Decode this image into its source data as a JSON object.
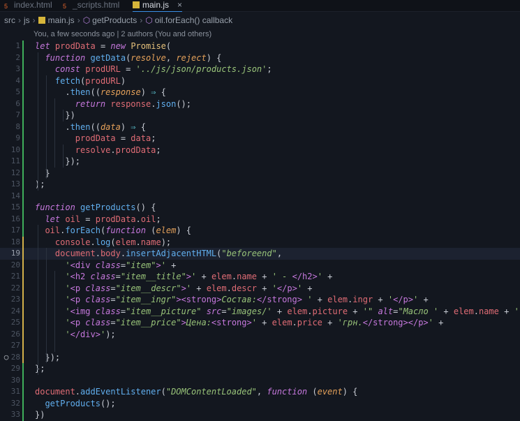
{
  "tabs": [
    {
      "label": "index.html",
      "icon": "html5-icon",
      "active": false
    },
    {
      "label": "_scripts.html",
      "icon": "html5-icon",
      "active": false
    },
    {
      "label": "main.js",
      "icon": "js-file-icon",
      "active": true
    }
  ],
  "tab_close_glyph": "×",
  "breadcrumb": [
    "src",
    "js",
    "main.js",
    "getProducts",
    "oil.forEach() callback"
  ],
  "blame": "You, a few seconds ago | 2 authors (You and others)",
  "current_line": 19,
  "colors": {
    "background": "#13171f",
    "keyword": "#c678dd",
    "function": "#61afef",
    "string": "#98c379",
    "variable": "#e06c75",
    "git_added": "#d2b04a",
    "git_new": "#3fae5a"
  },
  "lines": [
    {
      "n": "1",
      "marker": "",
      "git": "new",
      "tokens": [
        [
          "k",
          "let"
        ],
        [
          "pu",
          " "
        ],
        [
          "vr",
          "prodData"
        ],
        [
          "pu",
          " = "
        ],
        [
          "k",
          "new"
        ],
        [
          "pu",
          " "
        ],
        [
          "cl",
          "Promise"
        ],
        [
          "pu",
          "("
        ]
      ]
    },
    {
      "n": "2",
      "marker": "",
      "git": "new",
      "tokens": [
        [
          "pu",
          "  "
        ],
        [
          "k",
          "function"
        ],
        [
          "pu",
          " "
        ],
        [
          "fn",
          "getData"
        ],
        [
          "pu",
          "("
        ],
        [
          "par",
          "resolve"
        ],
        [
          "pu",
          ", "
        ],
        [
          "par",
          "reject"
        ],
        [
          "pu",
          ") {"
        ]
      ]
    },
    {
      "n": "3",
      "marker": "",
      "git": "new",
      "tokens": [
        [
          "pu",
          "    "
        ],
        [
          "k",
          "const"
        ],
        [
          "pu",
          " "
        ],
        [
          "vr",
          "prodURL"
        ],
        [
          "pu",
          " = "
        ],
        [
          "str",
          "'../js/json/products.json'"
        ],
        [
          "pu",
          ";"
        ]
      ]
    },
    {
      "n": "4",
      "marker": "",
      "git": "new",
      "tokens": [
        [
          "pu",
          "    "
        ],
        [
          "fn",
          "fetch"
        ],
        [
          "pu",
          "("
        ],
        [
          "vr",
          "prodURL"
        ],
        [
          "pu",
          ")"
        ]
      ]
    },
    {
      "n": "5",
      "marker": "",
      "git": "new",
      "tokens": [
        [
          "pu",
          "      ."
        ],
        [
          "fn",
          "then"
        ],
        [
          "pu",
          "(("
        ],
        [
          "par",
          "response"
        ],
        [
          "pu",
          ") "
        ],
        [
          "op",
          "⇒"
        ],
        [
          "pu",
          " {"
        ]
      ]
    },
    {
      "n": "6",
      "marker": "",
      "git": "new",
      "tokens": [
        [
          "pu",
          "        "
        ],
        [
          "k",
          "return"
        ],
        [
          "pu",
          " "
        ],
        [
          "vr",
          "response"
        ],
        [
          "pu",
          "."
        ],
        [
          "fn",
          "json"
        ],
        [
          "pu",
          "();"
        ]
      ]
    },
    {
      "n": "7",
      "marker": "",
      "git": "new",
      "tokens": [
        [
          "pu",
          "      })"
        ]
      ]
    },
    {
      "n": "8",
      "marker": "",
      "git": "new",
      "tokens": [
        [
          "pu",
          "      ."
        ],
        [
          "fn",
          "then"
        ],
        [
          "pu",
          "(("
        ],
        [
          "par",
          "data"
        ],
        [
          "pu",
          ") "
        ],
        [
          "op",
          "⇒"
        ],
        [
          "pu",
          " {"
        ]
      ]
    },
    {
      "n": "9",
      "marker": "",
      "git": "new",
      "tokens": [
        [
          "pu",
          "        "
        ],
        [
          "vr",
          "prodData"
        ],
        [
          "pu",
          " = "
        ],
        [
          "vr",
          "data"
        ],
        [
          "pu",
          ";"
        ]
      ]
    },
    {
      "n": "10",
      "marker": "",
      "git": "new",
      "tokens": [
        [
          "pu",
          "        "
        ],
        [
          "vr",
          "resolve"
        ],
        [
          "pu",
          "."
        ],
        [
          "pr",
          "prodData"
        ],
        [
          "pu",
          ";"
        ]
      ]
    },
    {
      "n": "11",
      "marker": "",
      "git": "new",
      "tokens": [
        [
          "pu",
          "      });"
        ]
      ]
    },
    {
      "n": "12",
      "marker": "",
      "git": "new",
      "tokens": [
        [
          "pu",
          "  }"
        ]
      ]
    },
    {
      "n": "13",
      "marker": "",
      "git": "new",
      "tokens": [
        [
          "pu",
          ");"
        ]
      ]
    },
    {
      "n": "14",
      "marker": "",
      "git": "new",
      "tokens": []
    },
    {
      "n": "15",
      "marker": "",
      "git": "new",
      "tokens": [
        [
          "k",
          "function"
        ],
        [
          "pu",
          " "
        ],
        [
          "fn",
          "getProducts"
        ],
        [
          "pu",
          "() {"
        ]
      ]
    },
    {
      "n": "16",
      "marker": "",
      "git": "new",
      "tokens": [
        [
          "pu",
          "  "
        ],
        [
          "k",
          "let"
        ],
        [
          "pu",
          " "
        ],
        [
          "vr",
          "oil"
        ],
        [
          "pu",
          " = "
        ],
        [
          "vr",
          "prodData"
        ],
        [
          "pu",
          "."
        ],
        [
          "pr",
          "oil"
        ],
        [
          "pu",
          ";"
        ]
      ]
    },
    {
      "n": "17",
      "marker": "",
      "git": "new",
      "tokens": [
        [
          "pu",
          "  "
        ],
        [
          "vr",
          "oil"
        ],
        [
          "pu",
          "."
        ],
        [
          "fn",
          "forEach"
        ],
        [
          "pu",
          "("
        ],
        [
          "k",
          "function"
        ],
        [
          "pu",
          " ("
        ],
        [
          "par",
          "elem"
        ],
        [
          "pu",
          ") "
        ],
        [
          "pu",
          "{"
        ]
      ]
    },
    {
      "n": "18",
      "marker": "",
      "git": "added",
      "tokens": [
        [
          "pu",
          "    "
        ],
        [
          "vr",
          "console"
        ],
        [
          "pu",
          "."
        ],
        [
          "fn",
          "log"
        ],
        [
          "pu",
          "("
        ],
        [
          "vr",
          "elem"
        ],
        [
          "pu",
          "."
        ],
        [
          "pr",
          "name"
        ],
        [
          "pu",
          ");"
        ]
      ]
    },
    {
      "n": "19",
      "marker": "",
      "git": "added",
      "tokens": [
        [
          "pu",
          "    "
        ],
        [
          "vr",
          "document"
        ],
        [
          "pu",
          "."
        ],
        [
          "pr",
          "body"
        ],
        [
          "pu",
          "."
        ],
        [
          "fn",
          "insertAdjacentHTML"
        ],
        [
          "pu",
          "("
        ],
        [
          "str",
          "\"beforeend\""
        ],
        [
          "pu",
          ","
        ]
      ]
    },
    {
      "n": "20",
      "marker": "",
      "git": "added",
      "tokens": [
        [
          "pu",
          "      "
        ],
        [
          "str",
          "'"
        ],
        [
          "tg",
          "<div"
        ],
        [
          "pu",
          " "
        ],
        [
          "at",
          "class"
        ],
        [
          "pu",
          "="
        ],
        [
          "str",
          "\"item\""
        ],
        [
          "tg",
          ">"
        ],
        [
          "str",
          "'"
        ],
        [
          "pu",
          " +"
        ]
      ]
    },
    {
      "n": "21",
      "marker": "",
      "git": "added",
      "tokens": [
        [
          "pu",
          "      "
        ],
        [
          "str",
          "'"
        ],
        [
          "tg",
          "<h2"
        ],
        [
          "pu",
          " "
        ],
        [
          "at",
          "class"
        ],
        [
          "pu",
          "="
        ],
        [
          "str",
          "\"item__title\""
        ],
        [
          "tg",
          ">"
        ],
        [
          "str",
          "'"
        ],
        [
          "pu",
          " + "
        ],
        [
          "vr",
          "elem"
        ],
        [
          "pu",
          "."
        ],
        [
          "pr",
          "name"
        ],
        [
          "pu",
          " + "
        ],
        [
          "str",
          "' - "
        ],
        [
          "tg",
          "</h2>"
        ],
        [
          "str",
          "'"
        ],
        [
          "pu",
          " +"
        ]
      ]
    },
    {
      "n": "22",
      "marker": "",
      "git": "added",
      "tokens": [
        [
          "pu",
          "      "
        ],
        [
          "str",
          "'"
        ],
        [
          "tg",
          "<p"
        ],
        [
          "pu",
          " "
        ],
        [
          "at",
          "class"
        ],
        [
          "pu",
          "="
        ],
        [
          "str",
          "\"item__descr\""
        ],
        [
          "tg",
          ">"
        ],
        [
          "str",
          "'"
        ],
        [
          "pu",
          " + "
        ],
        [
          "vr",
          "elem"
        ],
        [
          "pu",
          "."
        ],
        [
          "pr",
          "descr"
        ],
        [
          "pu",
          " + "
        ],
        [
          "str",
          "'"
        ],
        [
          "tg",
          "</p>"
        ],
        [
          "str",
          "'"
        ],
        [
          "pu",
          " +"
        ]
      ]
    },
    {
      "n": "23",
      "marker": "",
      "git": "added",
      "tokens": [
        [
          "pu",
          "      "
        ],
        [
          "str",
          "'"
        ],
        [
          "tg",
          "<p"
        ],
        [
          "pu",
          " "
        ],
        [
          "at",
          "class"
        ],
        [
          "pu",
          "="
        ],
        [
          "str",
          "\"item__ingr\""
        ],
        [
          "tg",
          "><strong>"
        ],
        [
          "str",
          "Состав:"
        ],
        [
          "tg",
          "</strong>"
        ],
        [
          "str",
          " '"
        ],
        [
          "pu",
          " + "
        ],
        [
          "vr",
          "elem"
        ],
        [
          "pu",
          "."
        ],
        [
          "pr",
          "ingr"
        ],
        [
          "pu",
          " + "
        ],
        [
          "str",
          "'"
        ],
        [
          "tg",
          "</p>"
        ],
        [
          "str",
          "'"
        ],
        [
          "pu",
          " +"
        ]
      ]
    },
    {
      "n": "24",
      "marker": "",
      "git": "added",
      "tokens": [
        [
          "pu",
          "      "
        ],
        [
          "str",
          "'"
        ],
        [
          "tg",
          "<img"
        ],
        [
          "pu",
          " "
        ],
        [
          "at",
          "class"
        ],
        [
          "pu",
          "="
        ],
        [
          "str",
          "\"item__picture\""
        ],
        [
          "pu",
          " "
        ],
        [
          "at",
          "src"
        ],
        [
          "pu",
          "="
        ],
        [
          "str",
          "\"images/'"
        ],
        [
          "pu",
          " + "
        ],
        [
          "vr",
          "elem"
        ],
        [
          "pu",
          "."
        ],
        [
          "pr",
          "picture"
        ],
        [
          "pu",
          " + "
        ],
        [
          "str",
          "'\""
        ],
        [
          "pu",
          " "
        ],
        [
          "at",
          "alt"
        ],
        [
          "pu",
          "="
        ],
        [
          "str",
          "\"Масло '"
        ],
        [
          "pu",
          " + "
        ],
        [
          "vr",
          "elem"
        ],
        [
          "pu",
          "."
        ],
        [
          "pr",
          "name"
        ],
        [
          "pu",
          " + "
        ],
        [
          "str",
          "'\""
        ],
        [
          "tg",
          ">"
        ],
        [
          "str",
          "'"
        ],
        [
          "pu",
          " +"
        ]
      ]
    },
    {
      "n": "25",
      "marker": "",
      "git": "added",
      "tokens": [
        [
          "pu",
          "      "
        ],
        [
          "str",
          "'"
        ],
        [
          "tg",
          "<p"
        ],
        [
          "pu",
          " "
        ],
        [
          "at",
          "class"
        ],
        [
          "pu",
          "="
        ],
        [
          "str",
          "\"item__price\""
        ],
        [
          "tg",
          ">"
        ],
        [
          "str",
          "Цена:"
        ],
        [
          "tg",
          "<strong>"
        ],
        [
          "str",
          "'"
        ],
        [
          "pu",
          " + "
        ],
        [
          "vr",
          "elem"
        ],
        [
          "pu",
          "."
        ],
        [
          "pr",
          "price"
        ],
        [
          "pu",
          " + "
        ],
        [
          "str",
          "'грн."
        ],
        [
          "tg",
          "</strong></p>"
        ],
        [
          "str",
          "'"
        ],
        [
          "pu",
          " +"
        ]
      ]
    },
    {
      "n": "26",
      "marker": "",
      "git": "added",
      "tokens": [
        [
          "pu",
          "      "
        ],
        [
          "str",
          "'"
        ],
        [
          "tg",
          "</div>"
        ],
        [
          "str",
          "'"
        ],
        [
          "pu",
          ");"
        ]
      ]
    },
    {
      "n": "27",
      "marker": "",
      "git": "added",
      "tokens": []
    },
    {
      "n": "28",
      "marker": "○",
      "git": "added",
      "tokens": [
        [
          "pu",
          "  "
        ],
        [
          "pu",
          "}"
        ],
        [
          "pu",
          ");"
        ]
      ]
    },
    {
      "n": "29",
      "marker": "",
      "git": "new",
      "tokens": [
        [
          "pu",
          "};"
        ]
      ]
    },
    {
      "n": "30",
      "marker": "",
      "git": "new",
      "tokens": []
    },
    {
      "n": "31",
      "marker": "",
      "git": "new",
      "tokens": [
        [
          "vr",
          "document"
        ],
        [
          "pu",
          "."
        ],
        [
          "fn",
          "addEventListener"
        ],
        [
          "pu",
          "("
        ],
        [
          "str",
          "\"DOMContentLoaded\""
        ],
        [
          "pu",
          ", "
        ],
        [
          "k",
          "function"
        ],
        [
          "pu",
          " ("
        ],
        [
          "par",
          "event"
        ],
        [
          "pu",
          ") {"
        ]
      ]
    },
    {
      "n": "32",
      "marker": "",
      "git": "new",
      "tokens": [
        [
          "pu",
          "  "
        ],
        [
          "fn",
          "getProducts"
        ],
        [
          "pu",
          "();"
        ]
      ]
    },
    {
      "n": "33",
      "marker": "",
      "git": "new",
      "tokens": [
        [
          "pu",
          "})"
        ]
      ]
    }
  ]
}
